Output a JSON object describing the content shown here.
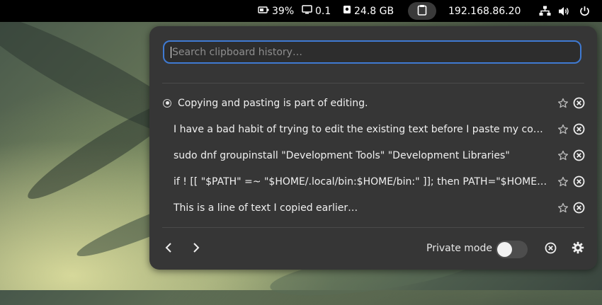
{
  "topbar": {
    "battery": "39%",
    "load": "0.1",
    "disk": "24.8 GB",
    "ip": "192.168.86.20",
    "icons": [
      "battery-icon",
      "monitor-icon",
      "disk-icon",
      "clipboard-icon",
      "network-icon",
      "volume-icon",
      "power-icon"
    ]
  },
  "search": {
    "placeholder": "Search clipboard history…",
    "value": ""
  },
  "items": [
    {
      "text": "Copying and pasting is part of editing.",
      "selected": true
    },
    {
      "text": "I have a bad habit of trying to edit the existing text before I paste my copied text in. It's a silly way to work."
    },
    {
      "text": "sudo dnf groupinstall \"Development Tools\" \"Development Libraries\""
    },
    {
      "text": "if ! [[ \"$PATH\" =~ \"$HOME/.local/bin:$HOME/bin:\" ]]; then PATH=\"$HOME/.local/bin:$HOME/bin:$PATH\"; fi"
    },
    {
      "text": "This is a line of text I copied earlier…"
    }
  ],
  "footer": {
    "private_mode_label": "Private mode",
    "private_mode_on": false
  },
  "colors": {
    "accent": "#3f7ad2",
    "popup_bg": "#363636",
    "topbar_bg": "#000000"
  }
}
